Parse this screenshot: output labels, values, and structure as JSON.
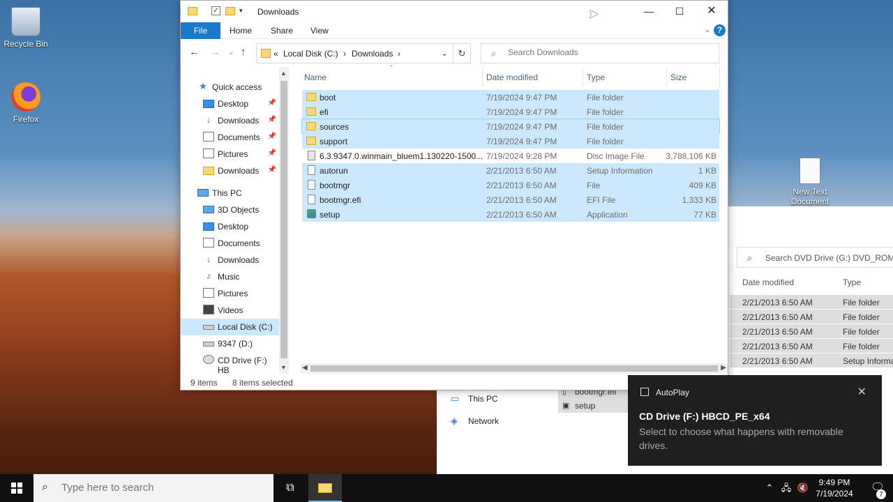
{
  "desktop": {
    "icons": [
      {
        "label": "Recycle Bin",
        "icon": "recycle-bin-icon"
      },
      {
        "label": "Firefox",
        "icon": "firefox-icon"
      },
      {
        "label": "New Text Document",
        "icon": "text-document-icon"
      }
    ]
  },
  "bg_window": {
    "search_placeholder": "Search DVD Drive (G:) DVD_ROM",
    "col_date": "Date modified",
    "col_type": "Type",
    "rows": [
      {
        "date": "2/21/2013 6:50 AM",
        "type": "File folder"
      },
      {
        "date": "2/21/2013 6:50 AM",
        "type": "File folder"
      },
      {
        "date": "2/21/2013 6:50 AM",
        "type": "File folder"
      },
      {
        "date": "2/21/2013 6:50 AM",
        "type": "File folder"
      },
      {
        "date": "2/21/2013 6:50 AM",
        "type": "Setup Informa"
      }
    ],
    "nav": [
      {
        "label": "This PC"
      },
      {
        "label": "Network"
      }
    ],
    "files": [
      {
        "name": "bootmgr.efi"
      },
      {
        "name": "setup"
      }
    ]
  },
  "window": {
    "title": "Downloads",
    "ribbon_tabs": [
      "File",
      "Home",
      "Share",
      "View"
    ],
    "help": "?",
    "address": {
      "prefix": "«",
      "segments": [
        "Local Disk (C:)",
        "Downloads"
      ],
      "separator": "›"
    },
    "search_placeholder": "Search Downloads",
    "nav": {
      "quick_access": "Quick access",
      "quick_items": [
        "Desktop",
        "Downloads",
        "Documents",
        "Pictures",
        "Downloads"
      ],
      "this_pc": "This PC",
      "pc_items": [
        "3D Objects",
        "Desktop",
        "Documents",
        "Downloads",
        "Music",
        "Pictures",
        "Videos",
        "Local Disk (C:)",
        "9347 (D:)",
        "CD Drive (F:) HB"
      ]
    },
    "columns": [
      "Name",
      "Date modified",
      "Type",
      "Size"
    ],
    "files": [
      {
        "name": "boot",
        "date": "7/19/2024 9:47 PM",
        "type": "File folder",
        "size": "",
        "icon": "folder-icon",
        "selected": true
      },
      {
        "name": "efi",
        "date": "7/19/2024 9:47 PM",
        "type": "File folder",
        "size": "",
        "icon": "folder-icon",
        "selected": true
      },
      {
        "name": "sources",
        "date": "7/19/2024 9:47 PM",
        "type": "File folder",
        "size": "",
        "icon": "folder-icon",
        "selected": true
      },
      {
        "name": "support",
        "date": "7/19/2024 9:47 PM",
        "type": "File folder",
        "size": "",
        "icon": "folder-icon",
        "selected": true
      },
      {
        "name": "6.3.9347.0.winmain_bluem1.130220-1500...",
        "date": "7/19/2024 9:28 PM",
        "type": "Disc Image File",
        "size": "3,788,106 KB",
        "icon": "disc-image-icon",
        "selected": false
      },
      {
        "name": "autorun",
        "date": "2/21/2013 6:50 AM",
        "type": "Setup Information",
        "size": "1 KB",
        "icon": "setup-info-icon",
        "selected": true
      },
      {
        "name": "bootmgr",
        "date": "2/21/2013 6:50 AM",
        "type": "File",
        "size": "409 KB",
        "icon": "file-icon",
        "selected": true
      },
      {
        "name": "bootmgr.efi",
        "date": "2/21/2013 6:50 AM",
        "type": "EFI File",
        "size": "1,333 KB",
        "icon": "file-icon",
        "selected": true
      },
      {
        "name": "setup",
        "date": "2/21/2013 6:50 AM",
        "type": "Application",
        "size": "77 KB",
        "icon": "application-icon",
        "selected": true
      }
    ],
    "status": {
      "items": "9 items",
      "selected": "8 items selected"
    }
  },
  "toast": {
    "app": "AutoPlay",
    "title": "CD Drive (F:) HBCD_PE_x64",
    "body": "Select to choose what happens with removable drives."
  },
  "taskbar": {
    "search_placeholder": "Type here to search",
    "time": "9:49 PM",
    "date": "7/19/2024",
    "notifications": "7"
  },
  "colors": {
    "selection": "#cce8ff",
    "accent": "#1979ca",
    "taskbar": "#101010",
    "toast": "#1f1f1f"
  }
}
